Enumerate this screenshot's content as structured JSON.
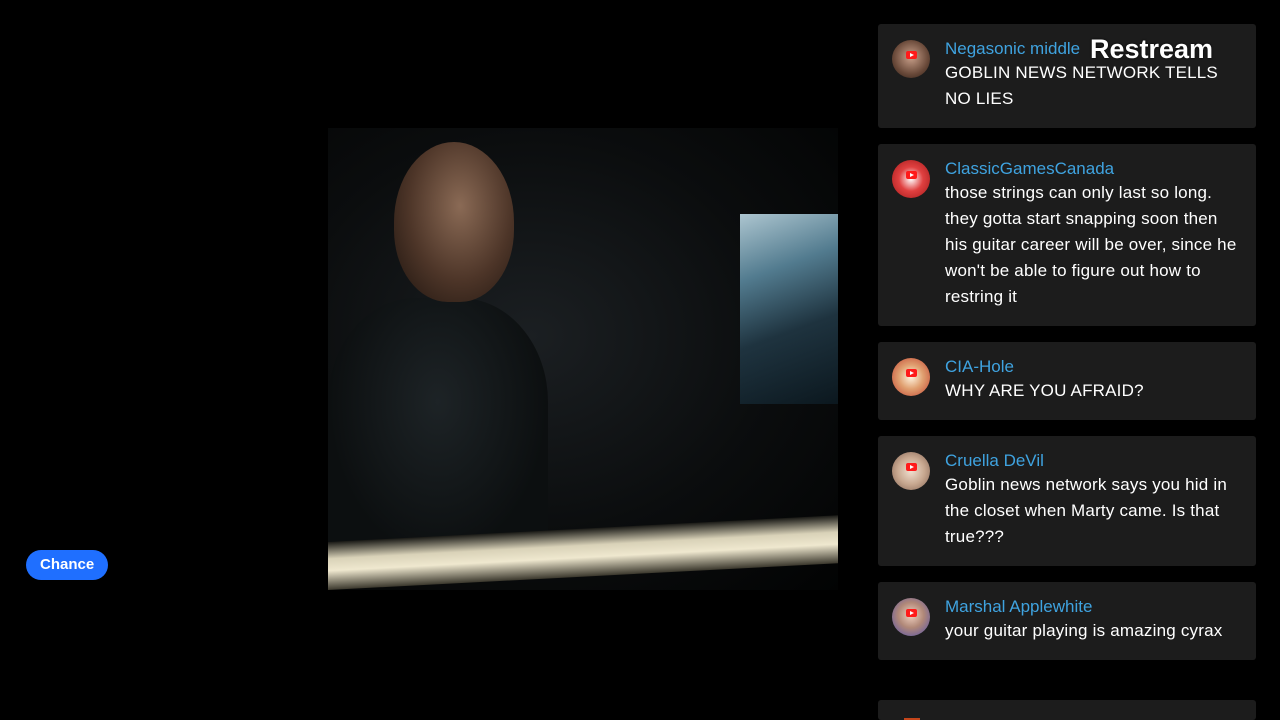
{
  "watermark": "Restream",
  "chance_button": "Chance",
  "chat": {
    "messages": [
      {
        "author": "Negasonic middle",
        "text": "GOBLIN NEWS NETWORK TELLS NO LIES",
        "avatar_color": "#7a5a4a"
      },
      {
        "author": "ClassicGamesCanada",
        "text": "those strings can only last so long. they gotta start snapping soon then his guitar career will be over, since he won't be able to figure out how to restring it",
        "avatar_color": "#c83030"
      },
      {
        "author": "CIA-Hole",
        "text": "WHY ARE YOU AFRAID?",
        "avatar_color": "#d8a070"
      },
      {
        "author": "Cruella DeVil",
        "text": "Goblin news network says you hid in the closet when Marty came. Is that true???",
        "avatar_color": "#b89880"
      },
      {
        "author": "Marshal Applewhite",
        "text": "your guitar playing is amazing cyrax",
        "avatar_color": "#8a8ad0"
      }
    ]
  },
  "colors": {
    "author": "#3fa3e0",
    "card_bg": "#1c1c1c",
    "chance_button": "#1f6fff",
    "youtube_badge": "#ff1a1a"
  }
}
